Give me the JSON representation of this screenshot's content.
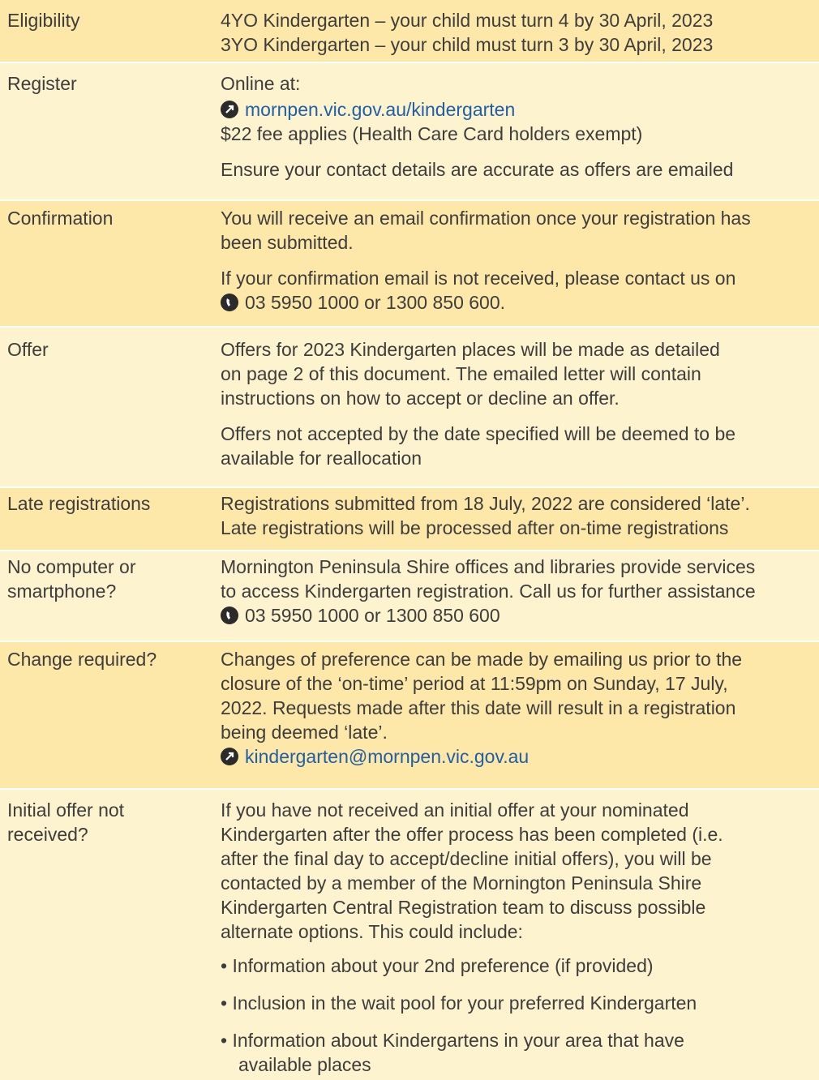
{
  "rows": [
    {
      "label": "Eligibility",
      "lines": [
        "4YO Kindergarten – your child must turn 4 by 30 April, 2023",
        "3YO Kindergarten – your child must turn 3 by 30 April, 2023"
      ]
    },
    {
      "label": "Register",
      "online_at": "Online at:",
      "link": "mornpen.vic.gov.au/kindergarten",
      "fee": "$22 fee applies (Health Care Card holders exempt)",
      "note": "Ensure your contact details are accurate as offers are emailed"
    },
    {
      "label": "Confirmation",
      "lines": [
        "You will receive an email confirmation once your registration has",
        "been submitted."
      ],
      "lines2": [
        "If your confirmation email is not received, please contact us on"
      ],
      "phone": "03 5950 1000 or 1300 850 600."
    },
    {
      "label": "Offer",
      "lines": [
        "Offers for 2023 Kindergarten places will be made as detailed",
        "on page 2 of this document. The emailed letter will contain",
        "instructions on how to accept or decline an offer."
      ],
      "lines2": [
        "Offers not accepted by the date specified will be deemed to be",
        "available for reallocation"
      ]
    },
    {
      "label": "Late registrations",
      "lines": [
        "Registrations submitted from 18 July, 2022 are considered ‘late’.",
        "Late registrations will be processed after on-time registrations"
      ]
    },
    {
      "label_lines": [
        "No computer or",
        "smartphone?"
      ],
      "lines": [
        "Mornington Peninsula Shire offices and libraries provide services",
        "to access Kindergarten registration. Call us for further assistance"
      ],
      "phone": "03 5950 1000 or 1300 850 600"
    },
    {
      "label": "Change required?",
      "lines": [
        "Changes of preference can be made by emailing us prior to the",
        "closure of the ‘on-time’ period at 11:59pm on Sunday, 17 July,",
        "2022. Requests made after this date will result in a registration",
        "being deemed ‘late’."
      ],
      "email": "kindergarten@mornpen.vic.gov.au"
    },
    {
      "label_lines": [
        "Initial offer not",
        "received?"
      ],
      "lines": [
        "If you have not received an initial offer at your nominated",
        "Kindergarten after the offer process has been completed (i.e.",
        "after the final day to accept/decline initial offers), you will be",
        "contacted by a member of the Mornington Peninsula Shire",
        "Kindergarten Central Registration team to discuss possible",
        "alternate options. This could include:"
      ],
      "bullets": [
        "• Information about your 2nd preference (if provided)",
        "• Inclusion in the wait pool for your preferred Kindergarten",
        "• Information about Kindergartens in your area that have"
      ],
      "bullet_cont": "available places"
    }
  ],
  "colors": {
    "dark": "#fde8a9",
    "light": "#fef3cf",
    "link": "#1f5fa8"
  },
  "icons": {
    "web": "arrow-icon",
    "phone": "phone-icon",
    "email": "arrow-icon"
  }
}
